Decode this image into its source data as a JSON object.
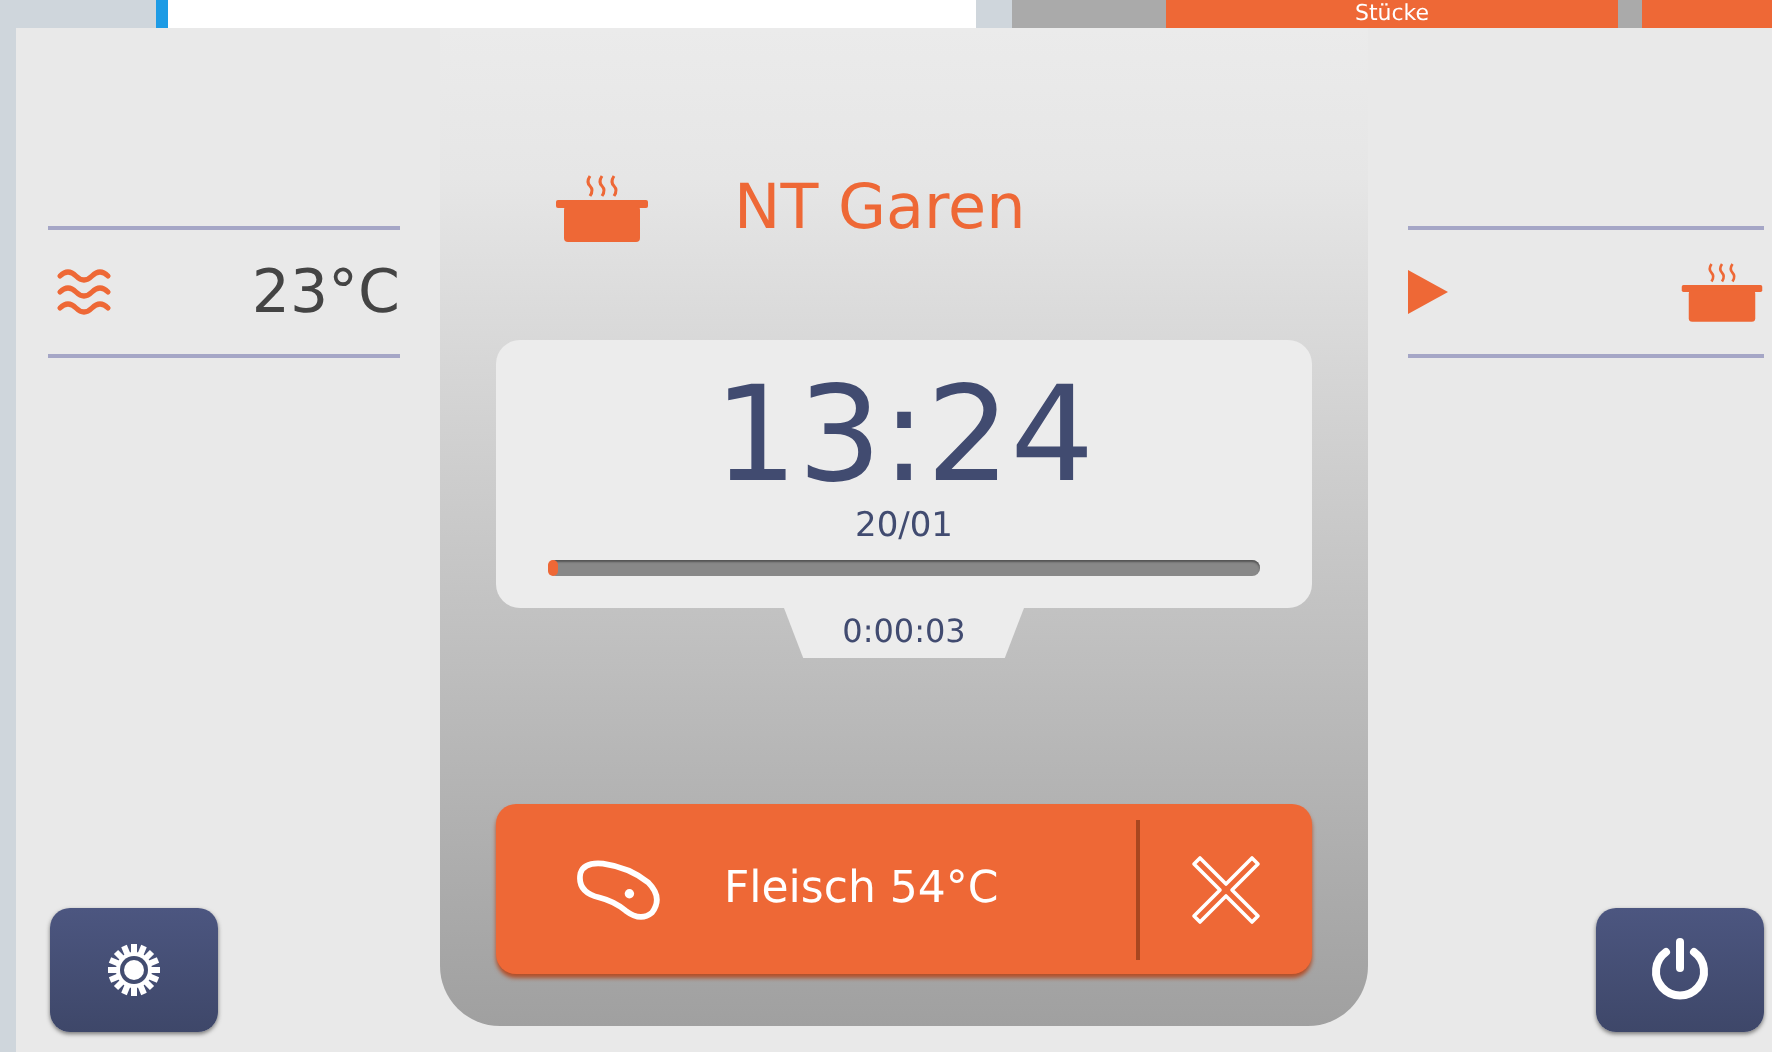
{
  "top_bar": {
    "button_label": "Stücke"
  },
  "climate": {
    "temperature": "23°C"
  },
  "program": {
    "title": "NT Garen",
    "time": "13:24",
    "date": "20/01",
    "progress": {
      "level": 0.01
    },
    "elapsed": "0:00:03",
    "probe": {
      "label": "Fleisch 54°C"
    }
  }
}
